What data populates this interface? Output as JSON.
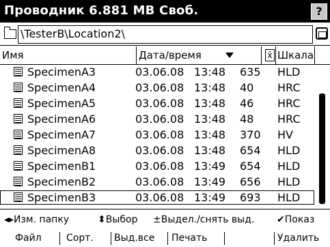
{
  "titlebar": {
    "title": "Проводник 6.881 MB Своб.",
    "help_label": "?"
  },
  "path": {
    "value": "\\TesterB\\Location2\\"
  },
  "columns": {
    "name": "Имя",
    "datetime": "Дата/время",
    "value_symbol": "x̄",
    "scale": "Шкала"
  },
  "rows": [
    {
      "name": "SpecimenA3",
      "date": "03.06.08",
      "time": "13:48",
      "value": "635",
      "scale": "HLD"
    },
    {
      "name": "SpecimenA4",
      "date": "03.06.08",
      "time": "13:48",
      "value": "40",
      "scale": "HRC"
    },
    {
      "name": "SpecimenA5",
      "date": "03.06.08",
      "time": "13:48",
      "value": "46",
      "scale": "HRC"
    },
    {
      "name": "SpecimenA6",
      "date": "03.06.08",
      "time": "13:48",
      "value": "48",
      "scale": "HRC"
    },
    {
      "name": "SpecimenA7",
      "date": "03.06.08",
      "time": "13:48",
      "value": "370",
      "scale": "HV"
    },
    {
      "name": "SpecimenA8",
      "date": "03.06.08",
      "time": "13:48",
      "value": "654",
      "scale": "HLD"
    },
    {
      "name": "SpecimenB1",
      "date": "03.06.08",
      "time": "13:49",
      "value": "654",
      "scale": "HLD"
    },
    {
      "name": "SpecimenB2",
      "date": "03.06.08",
      "time": "13:49",
      "value": "656",
      "scale": "HLD"
    },
    {
      "name": "SpecimenB3",
      "date": "03.06.08",
      "time": "13:49",
      "value": "693",
      "scale": "HLD"
    }
  ],
  "selected_index": 8,
  "hints": {
    "change_folder": "◂▸Изм. папку",
    "select": "⬍Выбор",
    "toggle_select": "±Выдел./снять выд.",
    "show": "✔Показ"
  },
  "menu": {
    "file": "Файл",
    "sort": "Сорт.",
    "select_all": "Выд.все",
    "print": "Печать",
    "delete": "Удалить"
  }
}
